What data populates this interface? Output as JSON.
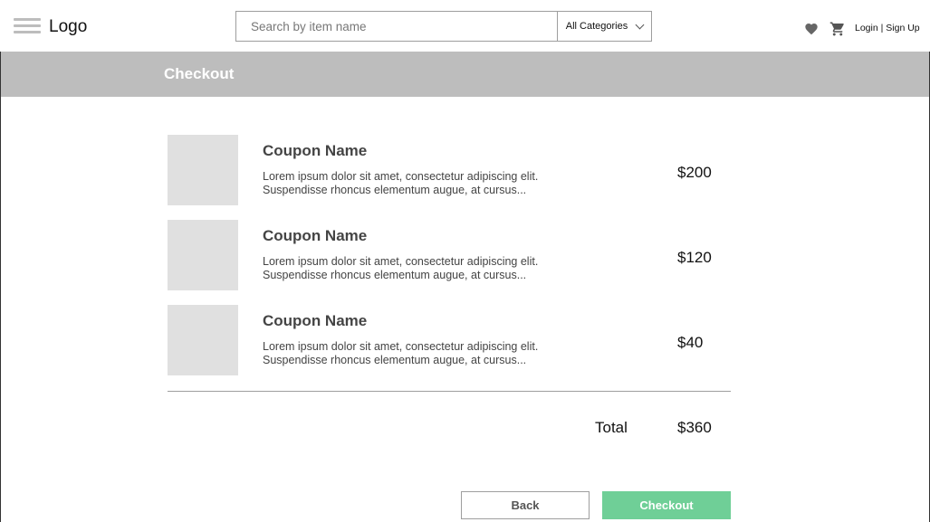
{
  "header": {
    "logo": "Logo",
    "search_placeholder": "Search by item name",
    "category": "All Categories",
    "login": "Login",
    "separator": " | ",
    "signup": "Sign Up"
  },
  "banner": {
    "title": "Checkout"
  },
  "items": [
    {
      "name": "Coupon Name",
      "desc_line1": "Lorem ipsum dolor sit amet, consectetur adipiscing elit.",
      "desc_line2": "Suspendisse rhoncus elementum augue, at cursus...",
      "price": "$200"
    },
    {
      "name": "Coupon Name",
      "desc_line1": "Lorem ipsum dolor sit amet, consectetur adipiscing elit.",
      "desc_line2": "Suspendisse rhoncus elementum augue, at cursus...",
      "price": "$120"
    },
    {
      "name": "Coupon Name",
      "desc_line1": "Lorem ipsum dolor sit amet, consectetur adipiscing elit.",
      "desc_line2": "Suspendisse rhoncus elementum augue, at cursus...",
      "price": "$40"
    }
  ],
  "summary": {
    "total_label": "Total",
    "total_value": "$360"
  },
  "actions": {
    "back_label": "Back",
    "checkout_label": "Checkout"
  },
  "icons": {
    "menu": "hamburger-menu-icon",
    "heart": "heart-icon",
    "cart": "cart-icon",
    "dropdown": "chevron-down-icon"
  },
  "colors": {
    "banner": "#bdbdbd",
    "checkout_button": "#6fcf97",
    "placeholder_block": "#e0e0e0"
  }
}
